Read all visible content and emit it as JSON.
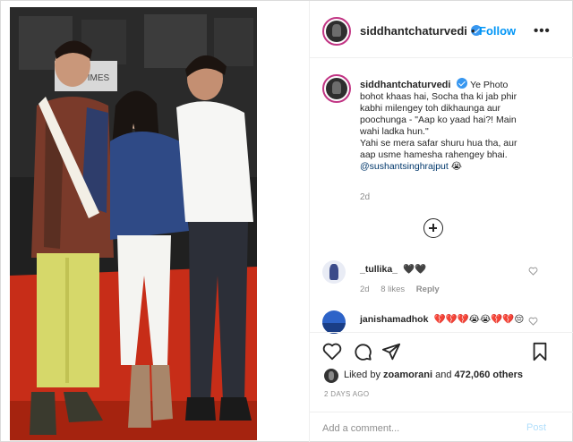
{
  "post": {
    "username": "siddhantchaturvedi",
    "follow_label": "Follow",
    "separator": "•",
    "more_label": "•••"
  },
  "caption": {
    "username": "siddhantchaturvedi",
    "lines": [
      "Ye Photo",
      "bohot khaas hai, Socha tha ki jab phir",
      "kabhi milengey toh dikhaunga aur",
      "poochunga - \"Aap ko yaad hai?! Main",
      "wahi ladka hun.\"",
      "Yahi se mera safar shuru hua tha, aur",
      "aap usme hamesha rahengey bhai."
    ],
    "mention": "@sushantsinghrajput",
    "emoji": "😭",
    "time": "2d"
  },
  "comments": [
    {
      "username": "_tullika_",
      "text": "🖤🖤",
      "time": "2d",
      "likes": "8 likes",
      "reply": "Reply"
    },
    {
      "username": "janishamadhok",
      "text": "💔💔💔😭😭💔💔😔"
    }
  ],
  "actions": {
    "liked_by_prefix": "Liked by",
    "liked_by_user": "zoamorani",
    "liked_by_and": "and",
    "liked_by_count": "472,060 others",
    "date": "2 DAYS AGO"
  },
  "add_comment": {
    "placeholder": "Add a comment...",
    "post_label": "Post"
  },
  "colors": {
    "accent": "#0095f6",
    "verified": "#3897f0",
    "muted": "#8e8e8e",
    "post_disabled": "#b2dffc"
  }
}
